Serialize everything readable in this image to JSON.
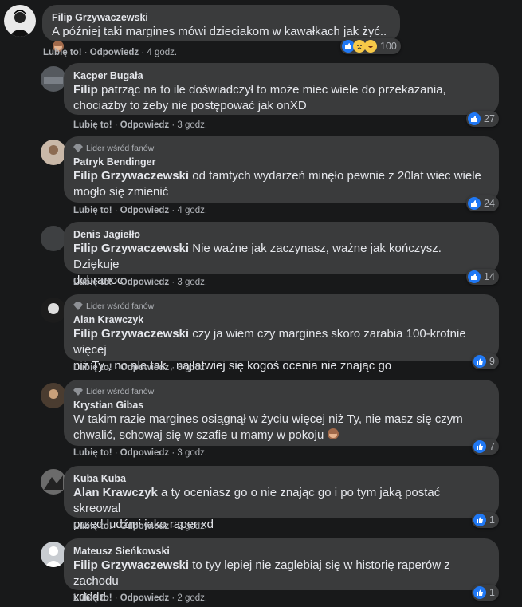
{
  "colors": {
    "background": "#18191a",
    "bubble": "#3a3b3c",
    "like_blue": "#2078f4",
    "muted": "#b0b3b8"
  },
  "actions": {
    "like": "Lubię to!",
    "reply": "Odpowiedz",
    "sep": "·"
  },
  "root_comment": {
    "author": "Filip Grzywaczewski",
    "text": "A później taki margines mówi dzieciakom w kawałkach jak żyć..",
    "emoji": "see-no-evil-monkey",
    "time": "4 godz.",
    "reaction_count": "100",
    "reactions": [
      "like-icon",
      "sad-icon",
      "haha-icon"
    ]
  },
  "replies": [
    {
      "author": "Kacper Bugała",
      "mention": "Filip",
      "text_line1": " patrząc na to ile doświadczył to może miec wiele do przekazania,",
      "text_line2": "chociażby to żeby nie postępować jak onXD",
      "time": "3 godz.",
      "reaction_count": "27",
      "fan_badge": ""
    },
    {
      "author": "Patryk Bendinger",
      "mention": "Filip Grzywaczewski",
      "text_line1": " od tamtych wydarzeń minęło pewnie z 20lat wiec wiele",
      "text_line2": "mogło się zmienić",
      "time": "4 godz.",
      "reaction_count": "24",
      "fan_badge": "Lider wśród fanów"
    },
    {
      "author": "Denis Jagiełło",
      "mention": "Filip Grzywaczewski",
      "text_line1": " Nie ważne jak zaczynasz, ważne jak kończysz. Dziękuje",
      "text_line2": "dobranoc",
      "time": "3 godz.",
      "reaction_count": "14",
      "fan_badge": ""
    },
    {
      "author": "Alan Krawczyk",
      "mention": "Filip Grzywaczewski",
      "text_line1": " czy ja wiem czy margines skoro zarabia 100-krotnie więcej",
      "text_line2": "niż Ty , no ale tak , najłatwiej się kogoś ocenia nie znając go",
      "time": "3 godz.",
      "reaction_count": "9",
      "fan_badge": "Lider wśród fanów"
    },
    {
      "author": "Krystian Gibas",
      "mention": "",
      "text_line1": "W takim razie margines osiągnął w życiu więcej niż Ty, nie masz się czym",
      "text_line2": "chwalić, schowaj się w szafie u mamy w pokoju",
      "time": "3 godz.",
      "reaction_count": "7",
      "fan_badge": "Lider wśród fanów"
    },
    {
      "author": "Kuba Kuba",
      "mention": "Alan Krawczyk",
      "text_line1": " a ty oceniasz go o nie znając go i po tym jaką postać skreowal",
      "text_line2": "przed ludźmi jako raper xd",
      "time": "2 godz.",
      "reaction_count": "1",
      "fan_badge": ""
    },
    {
      "author": "Mateusz Sieńkowski",
      "mention": "Filip Grzywaczewski",
      "text_line1": " to tyy lepiej nie zaglebiaj się w historię raperów z zachodu",
      "text_line2": "xdddd",
      "time": "2 godz.",
      "reaction_count": "1",
      "fan_badge": ""
    }
  ]
}
